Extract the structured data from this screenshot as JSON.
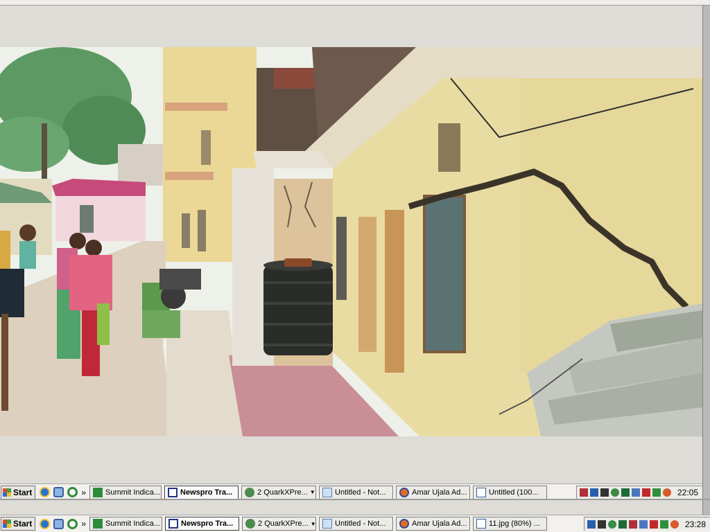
{
  "taskbar_top": {
    "start_label": "Start",
    "quicklaunch_icons": [
      "ie-icon",
      "desktop-icon",
      "media-player-icon"
    ],
    "overflow_label": "»",
    "buttons": [
      {
        "label": "Summit Indica...",
        "icon": "green-e-icon",
        "active": false
      },
      {
        "label": "Newspro Tra...",
        "icon": "newspro-icon",
        "active": true
      },
      {
        "label": "2 QuarkXPre...",
        "icon": "quark-icon",
        "active": false,
        "has_dropdown": true
      },
      {
        "label": "Untitled - Not...",
        "icon": "notepad-icon",
        "active": false
      },
      {
        "label": "Amar Ujala Ad...",
        "icon": "firefox-icon",
        "active": false
      },
      {
        "label": "Untitled (100...",
        "icon": "document-icon",
        "active": false
      }
    ],
    "clock": "22:05"
  },
  "taskbar_bottom": {
    "start_label": "Start",
    "quicklaunch_icons": [
      "ie-icon",
      "desktop-icon",
      "media-player-icon"
    ],
    "overflow_label": "»",
    "buttons": [
      {
        "label": "Summit Indica...",
        "icon": "green-e-icon",
        "active": false
      },
      {
        "label": "Newspro Tra...",
        "icon": "newspro-icon",
        "active": true
      },
      {
        "label": "2 QuarkXPre...",
        "icon": "quark-icon",
        "active": false,
        "has_dropdown": true
      },
      {
        "label": "Untitled - Not...",
        "icon": "notepad-icon",
        "active": false
      },
      {
        "label": "Amar Ujala Ad...",
        "icon": "firefox-icon",
        "active": false
      },
      {
        "label": "11.jpg (80%) ...",
        "icon": "document-icon",
        "active": false
      }
    ],
    "clock": "23:28"
  },
  "colors": {
    "wall_cream": "#e9dca2",
    "crack_dark": "#3a3428",
    "tank_black": "#2a2c2a",
    "path_pink": "#c98e96",
    "tree_green": "#5d9a63"
  }
}
